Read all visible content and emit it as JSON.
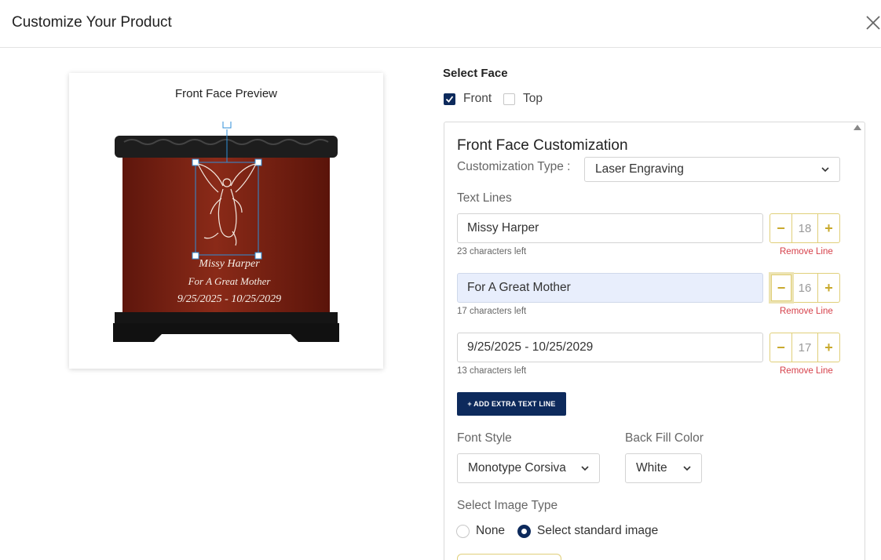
{
  "modal": {
    "title": "Customize Your Product"
  },
  "preview": {
    "title": "Front Face Preview",
    "engraving_lines": [
      "Missy Harper",
      "For A Great Mother",
      "9/25/2025 - 10/25/2029"
    ]
  },
  "select_face": {
    "title": "Select Face",
    "options": [
      {
        "label": "Front",
        "checked": true
      },
      {
        "label": "Top",
        "checked": false
      }
    ]
  },
  "customization": {
    "title": "Front Face Customization",
    "type_label": "Customization Type :",
    "type_value": "Laser Engraving",
    "text_lines_label": "Text Lines",
    "lines": [
      {
        "value": "Missy Harper",
        "chars_left": "23 characters left",
        "size": "18",
        "remove": "Remove Line",
        "focused": false
      },
      {
        "value": "For A Great Mother",
        "chars_left": "17 characters left",
        "size": "16",
        "remove": "Remove Line",
        "focused": true
      },
      {
        "value": "9/25/2025 - 10/25/2029",
        "chars_left": "13 characters left",
        "size": "17",
        "remove": "Remove Line",
        "focused": false
      }
    ],
    "add_line_label": "+ ADD EXTRA TEXT LINE",
    "font_style_label": "Font Style",
    "font_style_value": "Monotype Corsiva",
    "back_fill_label": "Back Fill Color",
    "back_fill_value": "White",
    "image_type_label": "Select Image Type",
    "image_type_options": [
      {
        "label": "None",
        "checked": false
      },
      {
        "label": "Select standard image",
        "checked": true
      }
    ]
  },
  "colors": {
    "primary": "#0d2a5c",
    "gold": "#c8a92c",
    "danger": "#d6404a",
    "urn_wood": "#7a1f12"
  },
  "icons": {
    "close": "close-icon",
    "check": "check-icon",
    "chevron": "chevron-down-icon"
  }
}
